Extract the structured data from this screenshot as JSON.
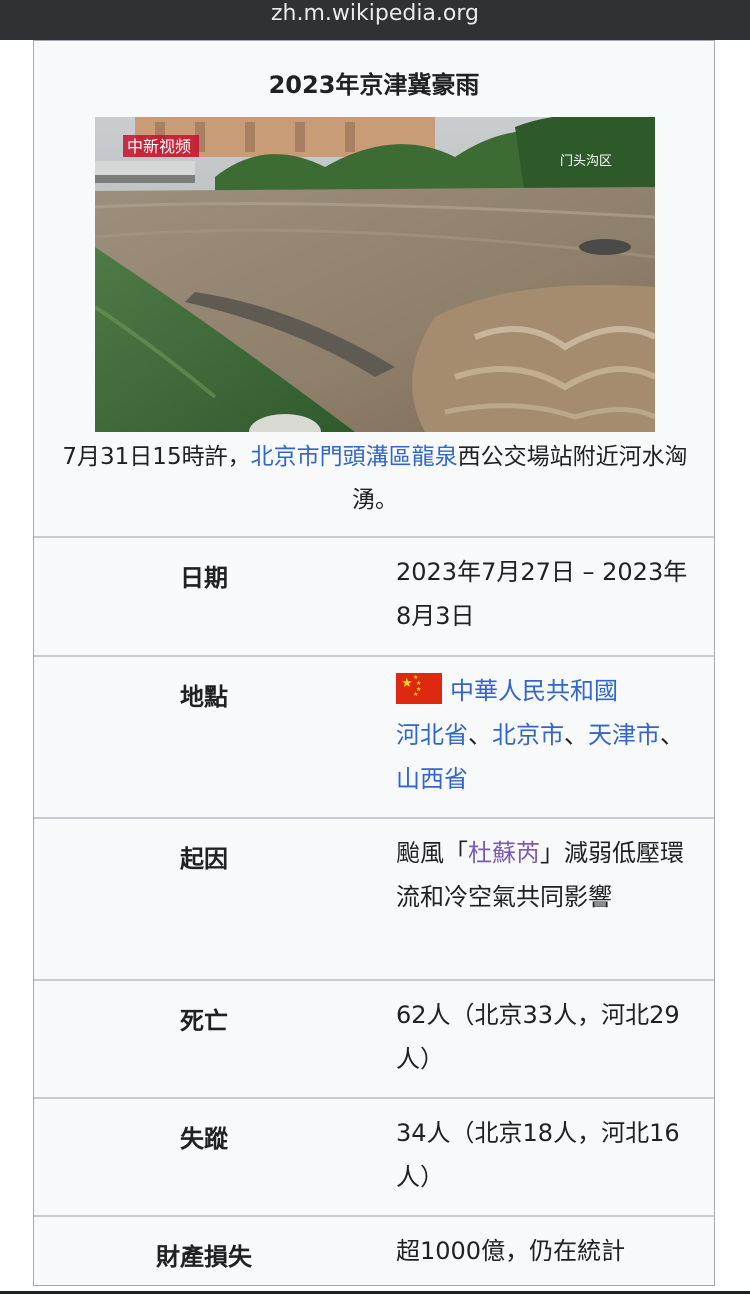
{
  "browser": {
    "url": "zh.m.wikipedia.org"
  },
  "infobox": {
    "title": "2023年京津冀豪雨",
    "image": {
      "watermark_logo": "中新视频",
      "watermark_location": "门头沟区"
    },
    "caption": {
      "prefix": "7月31日15時許，",
      "link": "北京市門頭溝區龍泉",
      "suffix": "西公交場站附近河水洶湧。"
    },
    "rows": {
      "date": {
        "label": "日期",
        "value": "2023年7月27日 – 2023年8月3日"
      },
      "location": {
        "label": "地點",
        "country": "中華人民共和國",
        "place1": "河北省",
        "sep1": "、",
        "place2": "北京市",
        "sep2": "、",
        "place3": "天津市",
        "sep3": "、",
        "place4": "山西省"
      },
      "cause": {
        "label": "起因",
        "prefix": "颱風「",
        "link": "杜蘇芮",
        "suffix": "」減弱低壓環流和冷空氣共同影響"
      },
      "deaths": {
        "label": "死亡",
        "value": "62人（北京33人，河北29人）"
      },
      "missing": {
        "label": "失蹤",
        "value": "34人（北京18人，河北16人）"
      },
      "damage": {
        "label": "財產損失",
        "value": "超1000億，仍在統計"
      }
    }
  },
  "colors": {
    "link": "#3366cc",
    "visited_link": "#795cb2",
    "infobox_bg": "#f8f9fa",
    "border": "#a2a9b1"
  }
}
